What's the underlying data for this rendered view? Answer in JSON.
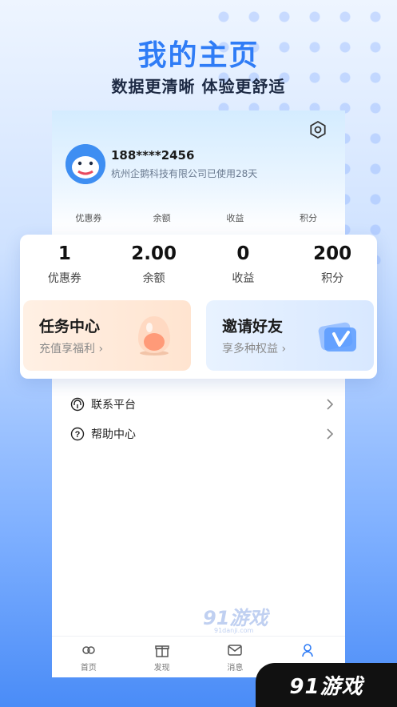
{
  "promo": {
    "title": "我的主页",
    "subtitle": "数据更清晰 体验更舒适"
  },
  "profile": {
    "phone": "188****2456",
    "company": "杭州企鹅科技有限公司已使用28天"
  },
  "mini_stats": [
    "优惠券",
    "余额",
    "收益",
    "积分"
  ],
  "stats": [
    {
      "value": "1",
      "label": "优惠券"
    },
    {
      "value": "2.00",
      "label": "余额"
    },
    {
      "value": "0",
      "label": "收益"
    },
    {
      "value": "200",
      "label": "积分"
    }
  ],
  "features": {
    "task": {
      "title": "任务中心",
      "subtitle": "充值享福利 ›"
    },
    "invite": {
      "title": "邀请好友",
      "subtitle": "享多种权益 ›"
    }
  },
  "menu": [
    {
      "label": "联系平台",
      "icon": "headset-icon"
    },
    {
      "label": "帮助中心",
      "icon": "help-icon"
    }
  ],
  "tabs": [
    {
      "label": "首页",
      "icon": "home-icon"
    },
    {
      "label": "发现",
      "icon": "gift-icon"
    },
    {
      "label": "消息",
      "icon": "message-icon"
    },
    {
      "label": "我的",
      "icon": "user-icon"
    }
  ],
  "watermark": {
    "logo": "91游戏",
    "url": "91danji.com"
  },
  "corner_logo": "91游戏",
  "colors": {
    "accent": "#2f7cf6",
    "task_bg": "#ffe4d0",
    "invite_bg": "#d8e8ff"
  }
}
